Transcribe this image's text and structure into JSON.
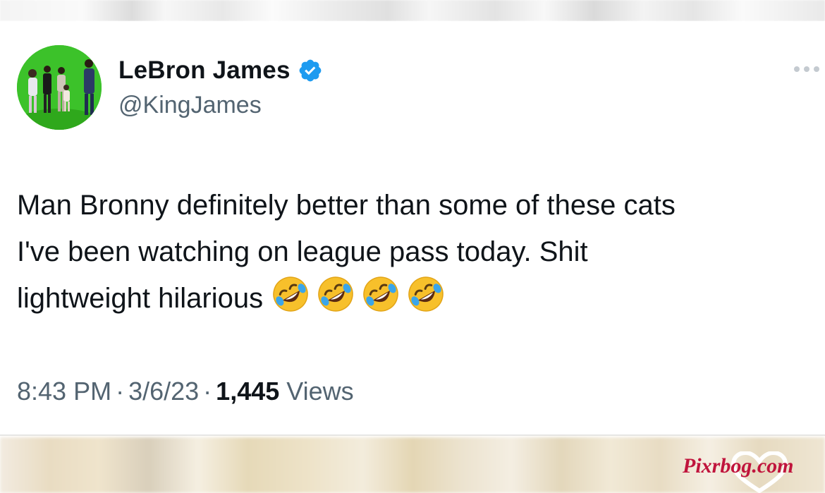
{
  "tweet": {
    "author": {
      "display_name": "LeBron James",
      "handle": "@KingJames",
      "verified": true
    },
    "text_lines": [
      "Man Bronny definitely better than some of these cats",
      "I've been watching on league pass today.  Shit",
      "lightweight hilarious"
    ],
    "emojis": [
      "rolling-on-floor-laughing",
      "rolling-on-floor-laughing",
      "rolling-on-floor-laughing",
      "rolling-on-floor-laughing"
    ],
    "time": "8:43 PM",
    "date": "3/6/23",
    "views_count": "1,445",
    "views_label": "Views",
    "separator": "·"
  },
  "watermark": {
    "text": "Pixrbog.com"
  },
  "colors": {
    "verified_badge": "#1d9bf0",
    "primary_text": "#0f1419",
    "secondary_text": "#536471",
    "watermark": "#c0143c",
    "avatar_green": "#35b81f"
  }
}
